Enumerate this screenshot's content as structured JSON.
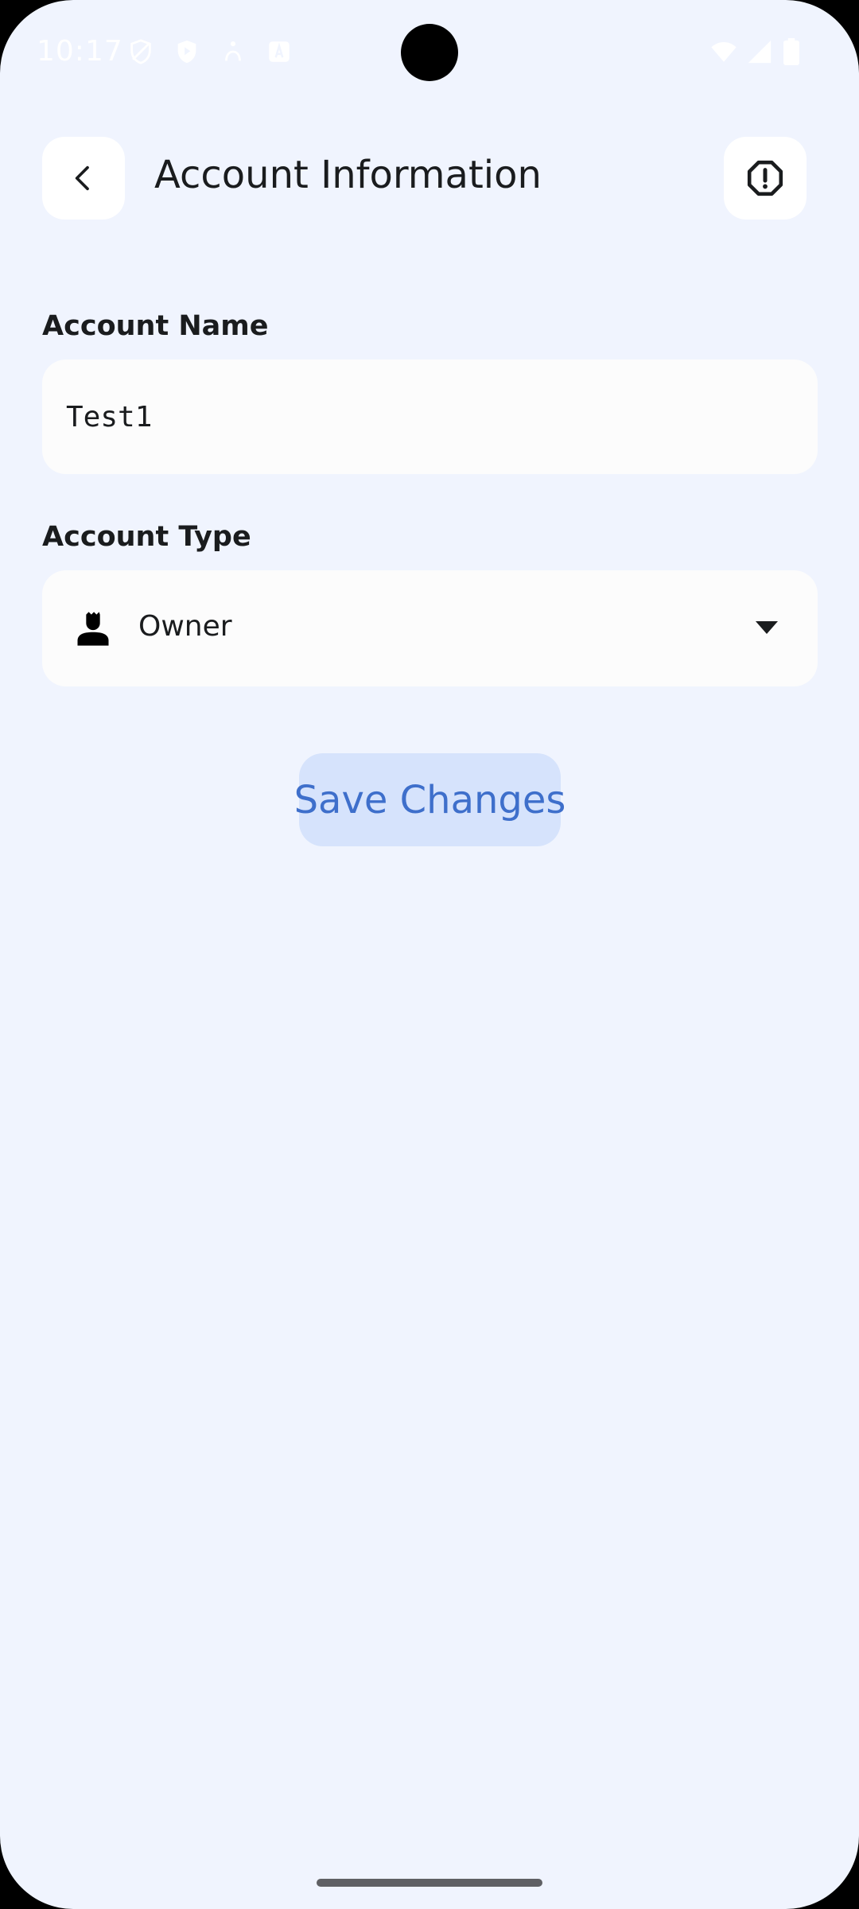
{
  "status_bar": {
    "time": "10:17",
    "left_icons": [
      "shield-outline-icon",
      "shield-play-icon",
      "person-accessibility-icon",
      "app-store-icon"
    ],
    "right_icons": [
      "wifi-icon",
      "cellular-signal-icon",
      "battery-icon"
    ]
  },
  "header": {
    "title": "Account Information",
    "back_icon": "chevron-left-icon",
    "action_icon": "octagon-alert-icon"
  },
  "form": {
    "account_name": {
      "label": "Account Name",
      "value": "Test1"
    },
    "account_type": {
      "label": "Account Type",
      "value": "Owner",
      "icon": "person-icon",
      "dropdown_icon": "caret-down-icon"
    }
  },
  "actions": {
    "save_label": "Save Changes"
  },
  "colors": {
    "background": "#f0f4fe",
    "surface": "#fcfcfc",
    "button_bg": "#d6e3fc",
    "button_text": "#3e6fcb",
    "text_primary": "#1a1c1e"
  }
}
